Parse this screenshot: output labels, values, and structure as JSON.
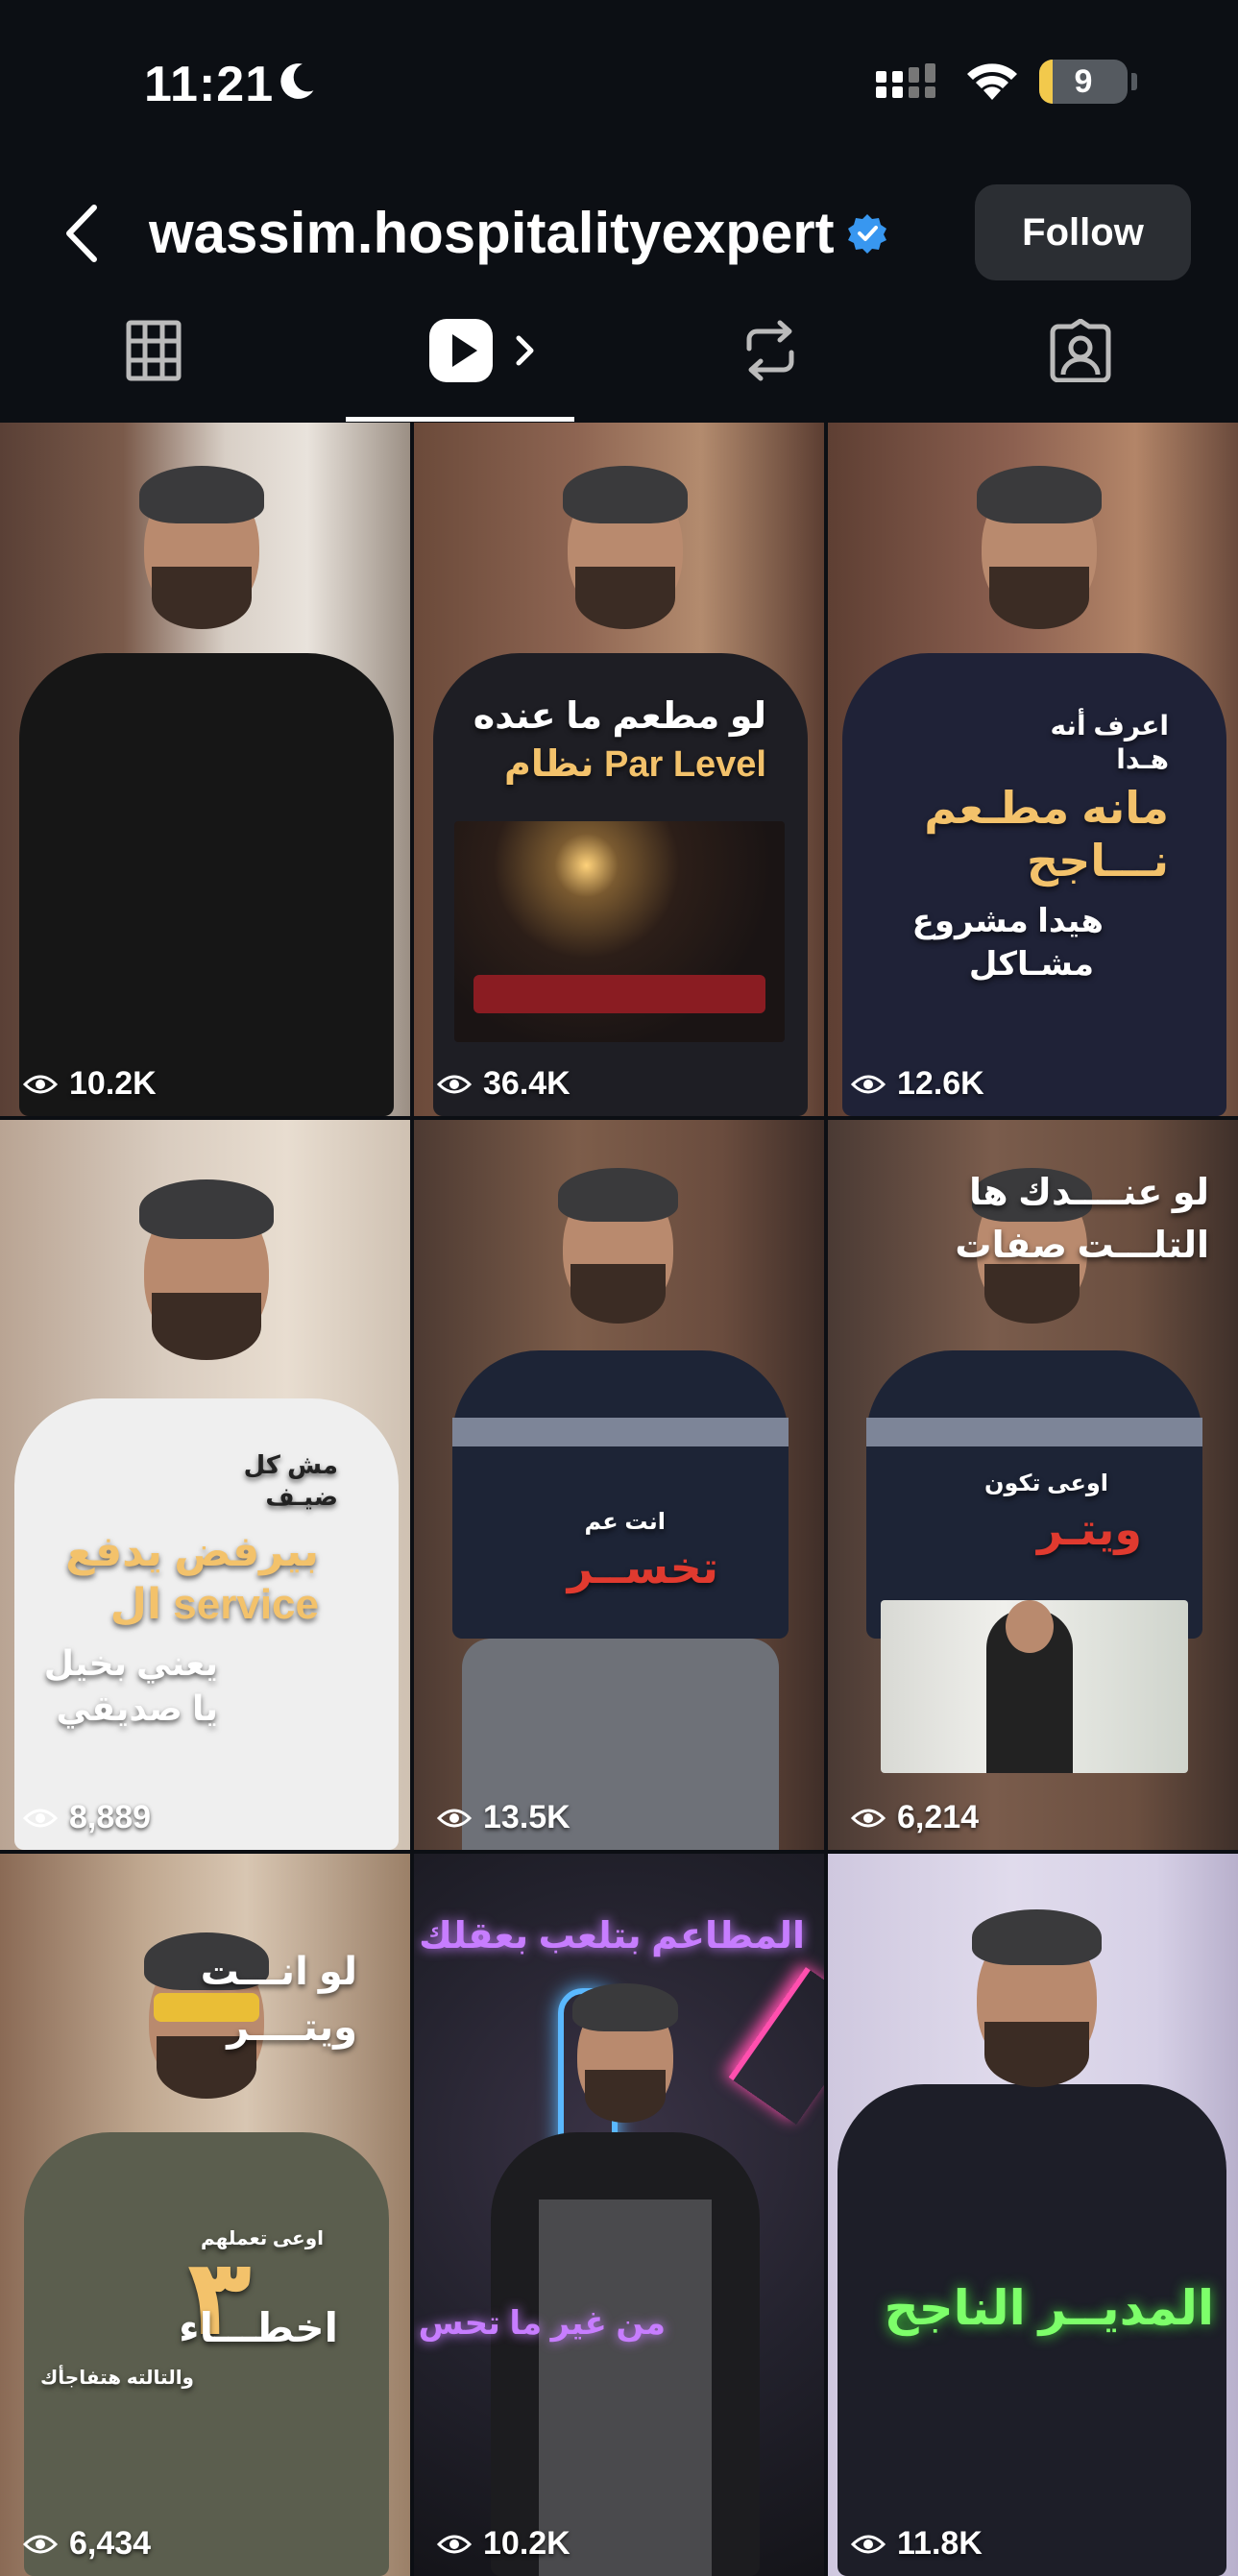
{
  "status_bar": {
    "time": "11:21",
    "battery": "9"
  },
  "header": {
    "username": "wassim.hospitalityexpert",
    "follow_label": "Follow"
  },
  "tabs": [
    {
      "name": "grid-tab-icon"
    },
    {
      "name": "reels-tab-icon"
    },
    {
      "name": "reposts-tab-icon"
    },
    {
      "name": "tagged-tab-icon"
    }
  ],
  "reels": [
    {
      "views": "10.2K",
      "text": []
    },
    {
      "views": "36.4K",
      "text": [
        "لو مطعم ما عنده",
        "نظام Par Level"
      ]
    },
    {
      "views": "12.6K",
      "text": [
        "اعرف أنه",
        "هـدا",
        "مانه مطـعم",
        "نـــاجح",
        "هيدا مشروع",
        "مشـاكل"
      ]
    },
    {
      "views": "8,889",
      "text": [
        "مش كل",
        "ضيـف",
        "بيرفض يدفع",
        "ال service",
        "يعني بخيل",
        "يا صديقي"
      ]
    },
    {
      "views": "13.5K",
      "text": [
        "انت عم",
        "تخســر"
      ]
    },
    {
      "views": "6,214",
      "text": [
        "لو عنــــدك ها",
        "التلـــت صفات",
        "اوعى تكون",
        "ويتـر"
      ]
    },
    {
      "views": "6,434",
      "text": [
        "لو انـــت",
        "ويتــــر",
        "اوعى تعملهم",
        "٣",
        "اخطـــاء",
        "والتالته هتفاجأك"
      ]
    },
    {
      "views": "10.2K",
      "text": [
        "المطاعم بتلعب بعقلك",
        "من غير ما تحس"
      ]
    },
    {
      "views": "11.8K",
      "text": [
        "المديــر الناجح"
      ]
    }
  ],
  "colors": {
    "accent_yellow": "#f3c26b",
    "accent_red": "#e03a2f",
    "verified_blue": "#3897f0",
    "neon_purple": "#c77dff",
    "neon_green": "#7dff6a"
  }
}
